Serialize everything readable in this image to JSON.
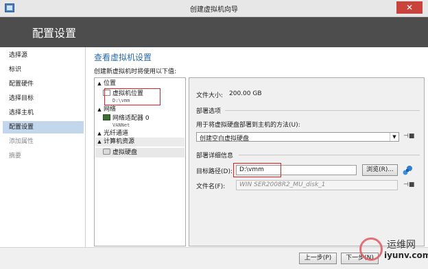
{
  "window": {
    "title": "创建虚拟机向导",
    "close_glyph": "✕"
  },
  "header": {
    "title": "配置设置"
  },
  "nav": {
    "items": [
      {
        "label": "选择源",
        "state": "normal"
      },
      {
        "label": "标识",
        "state": "normal"
      },
      {
        "label": "配置硬件",
        "state": "normal"
      },
      {
        "label": "选择目标",
        "state": "normal"
      },
      {
        "label": "选择主机",
        "state": "normal"
      },
      {
        "label": "配置设置",
        "state": "selected"
      },
      {
        "label": "添加属性",
        "state": "disabled"
      },
      {
        "label": "摘要",
        "state": "disabled"
      }
    ]
  },
  "main": {
    "title": "查看虚拟机设置",
    "subtitle": "创建新虚拟机时将使用以下值:",
    "tree": {
      "cat_location": "位置",
      "leaf_vm_location": "虚拟机位置",
      "leaf_vm_location_sub": "D:\\vmm",
      "cat_network": "网络",
      "leaf_adapter": "网络适配器 0",
      "leaf_adapter_sub": "VANNet",
      "cat_fiber": "光纤通道",
      "cat_compute": "计算机资源",
      "leaf_vhd": "虚拟硬盘"
    },
    "details": {
      "file_size_label": "文件大小:",
      "file_size_value": "200.00 GB",
      "deploy_options_heading": "部署选项",
      "deploy_method_label": "用于将虚拟硬盘部署到主机的方法(U):",
      "deploy_method_value": "创建空白虚拟硬盘",
      "deploy_details_heading": "部署详细信息",
      "target_path_label": "目标路径(D):",
      "target_path_value": "D:\\vmm",
      "browse_button": "浏览(R)...",
      "file_name_label": "文件名(F):",
      "file_name_value": "WIN SER2008R2_MU_disk_1"
    }
  },
  "footer": {
    "prev_button": "上一步(P)",
    "next_button": "下一步(N)"
  },
  "watermark": {
    "line1": "运维网",
    "line2": "iyunv.com"
  },
  "colors": {
    "header_bg": "#4d4d4d",
    "nav_selected": "#c2d6ec",
    "title_blue": "#2a6aa8",
    "annotation_red": "#e02020"
  }
}
